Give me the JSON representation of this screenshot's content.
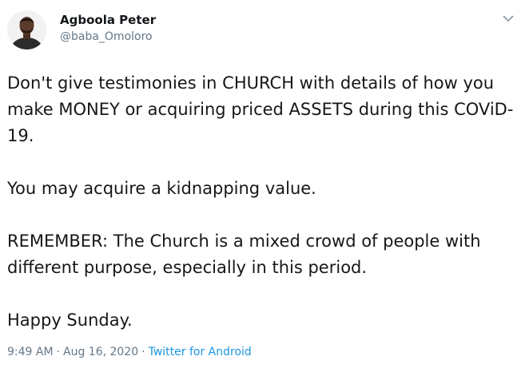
{
  "author": {
    "display_name": "Agboola Peter",
    "handle": "@baba_Omoloro"
  },
  "tweet": {
    "paragraphs": [
      "Don't give testimonies in CHURCH with details of how you make MONEY or acquiring priced ASSETS during this COViD-19.",
      "You may acquire a kidnapping value.",
      "REMEMBER: The Church is a mixed crowd of people with different purpose, especially in this period.",
      "Happy Sunday."
    ],
    "time": "9:49 AM",
    "date": "Aug 16, 2020",
    "separator": "·",
    "source": "Twitter for Android"
  },
  "icons": {
    "avatar": "profile-photo",
    "caret": "chevron-down-icon"
  },
  "colors": {
    "text": "#14171a",
    "muted": "#657786",
    "link": "#1b95e0"
  }
}
